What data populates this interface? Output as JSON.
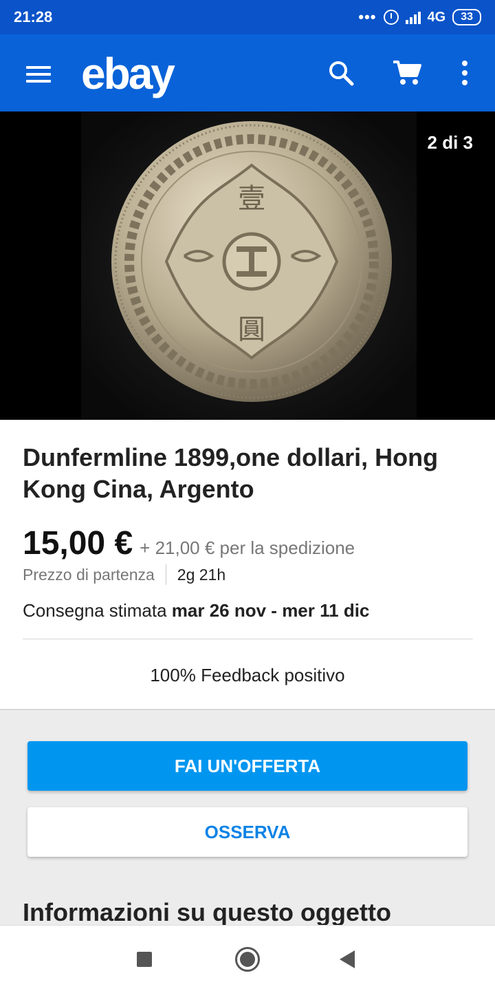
{
  "status_bar": {
    "time": "21:28",
    "dots": "•••",
    "network": "4G",
    "battery": "33"
  },
  "app_bar": {
    "logo": "ebay",
    "icons": [
      "menu-icon",
      "search-icon",
      "cart-icon",
      "more-vert-icon"
    ]
  },
  "gallery": {
    "counter": "2 di 3",
    "image": "silver-trade-dollar-coin"
  },
  "item": {
    "title": "Dunfermline 1899,one dollari, Hong Kong Cina, Argento",
    "price": "15,00 €",
    "shipping": "+ 21,00 € per la spedizione",
    "price_label": "Prezzo di partenza",
    "time_left": "2g 21h",
    "delivery_label": "Consegna stimata ",
    "delivery_dates": "mar 26 nov - mer 11 dic",
    "feedback": "100% Feedback positivo"
  },
  "actions": {
    "offer_label": "FAI UN'OFFERTA",
    "watch_label": "OSSERVA"
  },
  "sections": {
    "info_heading": "Informazioni su questo oggetto"
  },
  "colors": {
    "status_bar": "#0a53c9",
    "app_bar": "#0962d8",
    "primary_button": "#0096f0",
    "secondary_text": "#0a83e6"
  }
}
